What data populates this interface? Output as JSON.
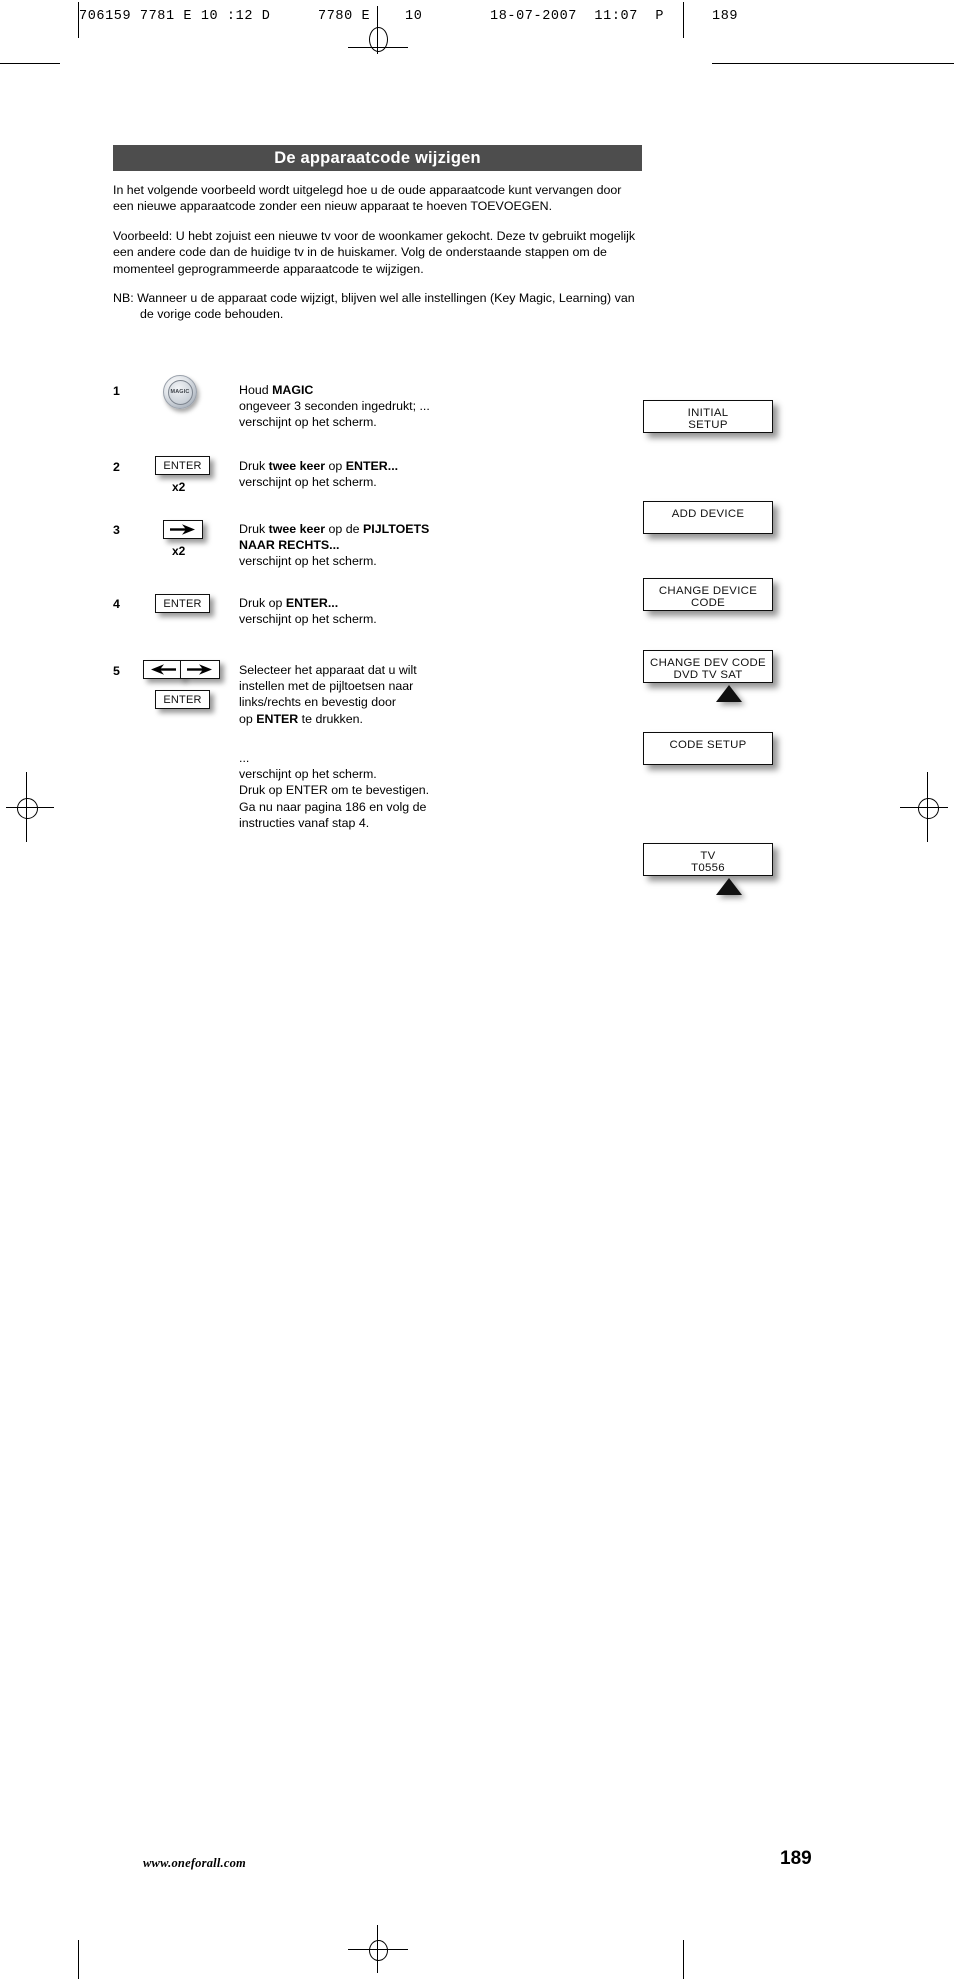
{
  "printer_slug": {
    "job_code": "706159 7781 E 10 :12 D",
    "plate_code": "7780 E    10",
    "datestamp": "18-07-2007  11:07  P",
    "page_marker": "189"
  },
  "document": {
    "title": "De apparaatcode wijzigen",
    "intro": "In het volgende voorbeeld wordt uitgelegd hoe u de oude apparaatcode kunt vervangen door een nieuwe apparaatcode zonder een nieuw apparaat te hoeven TOEVOEGEN.",
    "example": "Voorbeeld: U hebt zojuist een nieuwe tv voor de woonkamer gekocht. Deze tv gebruikt mogelijk een andere code dan de huidige tv in de huiskamer. Volg de onderstaande stappen om de momenteel geprogrammeerde apparaatcode te wijzigen.",
    "note": "NB: Wanneer u de apparaat code wijzigt, blijven wel alle instellingen (Key Magic, Learning) van de vorige code behouden."
  },
  "steps": [
    {
      "number": "1",
      "key_label": "MAGIC",
      "repeat": "",
      "text_lines": [
        {
          "plain": "Houd ",
          "bold": "MAGIC"
        },
        {
          "plain": "ongeveer 3 seconden ingedrukt; ...",
          "bold": ""
        },
        {
          "plain": "verschijnt op het scherm.",
          "bold": ""
        }
      ]
    },
    {
      "number": "2",
      "key_label": "ENTER",
      "repeat": "x2",
      "text_lines": [
        {
          "plain": "Druk ",
          "bold": "twee keer",
          "plain2": " op ",
          "bold2": "ENTER..."
        },
        {
          "plain": "verschijnt op het scherm.",
          "bold": ""
        }
      ]
    },
    {
      "number": "3",
      "key_label": "arrow-right-icon",
      "repeat": "x2",
      "text_lines": [
        {
          "plain": "Druk ",
          "bold": "twee keer",
          "plain2": " op de ",
          "bold2": "PIJLTOETS"
        },
        {
          "plain": "",
          "bold": "NAAR RECHTS..."
        },
        {
          "plain": "verschijnt op het scherm.",
          "bold": ""
        }
      ]
    },
    {
      "number": "4",
      "key_label": "ENTER",
      "repeat": "",
      "text_lines": [
        {
          "plain": "Druk op ",
          "bold": "ENTER..."
        },
        {
          "plain": "verschijnt op het scherm.",
          "bold": ""
        }
      ]
    },
    {
      "number": "5",
      "key_label": "ENTER",
      "repeat": "",
      "text_lines": [
        {
          "plain": "Selecteer het apparaat dat u wilt",
          "bold": ""
        },
        {
          "plain": "instellen met de pijltoetsen naar",
          "bold": ""
        },
        {
          "plain": "links/rechts en bevestig door",
          "bold": ""
        },
        {
          "plain": "op ",
          "bold": "ENTER",
          "plain2": " te drukken."
        }
      ]
    }
  ],
  "step5_tail": {
    "line1": "...",
    "line2": "verschijnt op het scherm.",
    "line3": "Druk op ENTER om te bevestigen.",
    "line4": "Ga nu naar pagina 186 en volg de",
    "line5": "instructies vanaf stap 4."
  },
  "labels": {
    "enter": "ENTER",
    "magic": "MAGIC",
    "x2": "x2"
  },
  "displays": [
    {
      "name": "initial-setup",
      "line1": "INITIAL",
      "line2": "SETUP",
      "caret": false,
      "devices": []
    },
    {
      "name": "add-device",
      "line1": "ADD DEVICE",
      "line2": "",
      "caret": false,
      "devices": []
    },
    {
      "name": "change-device-code",
      "line1": "CHANGE DEVICE",
      "line2": "CODE",
      "caret": false,
      "devices": []
    },
    {
      "name": "change-dev-code",
      "line1": "CHANGE DEV CODE",
      "line2": "",
      "caret": true,
      "devices": [
        "DVD",
        "TV",
        "SAT"
      ]
    },
    {
      "name": "code-setup",
      "line1": "CODE SETUP",
      "line2": "",
      "caret": false,
      "devices": []
    },
    {
      "name": "tv-code",
      "line1": "TV",
      "line2": "T0556",
      "caret": true,
      "devices": []
    }
  ],
  "footer": {
    "url": "www.oneforall.com",
    "page_number": "189"
  },
  "colors": {
    "title_band_bg": "#4d4d4d",
    "title_band_text": "#ffffff",
    "body_text": "#000000",
    "page_bg": "#ffffff"
  }
}
